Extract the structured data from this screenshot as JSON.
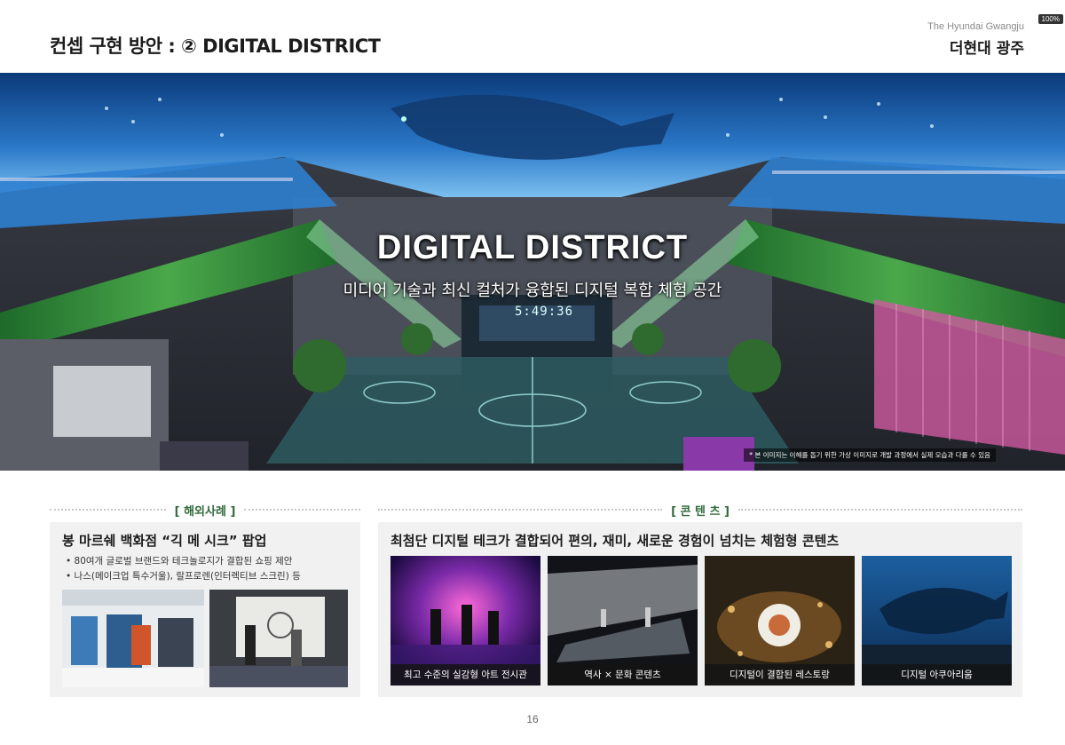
{
  "header": {
    "slide_title": "컨셉 구현 방안 : ② DIGITAL DISTRICT",
    "brand_en": "The Hyundai Gwangju",
    "brand_ko": "더현대 광주",
    "zoom_badge": "100%"
  },
  "hero": {
    "title": "DIGITAL DISTRICT",
    "subtitle": "미디어 기술과 최신 컬처가 융합된 디지털 복합 체험 공간",
    "clock": "5:49:36",
    "disclaimer": "* 본 이미지는 이해를 돕기 위한 가상 이미지로 개발 과정에서 실제 모습과 다를 수 있음"
  },
  "overseas": {
    "section_label": "[ 해외사례 ]",
    "case_title": "봉 마르쉐 백화점 “긱 메 시크” 팝업",
    "bullets": [
      "80여개 글로벌 브랜드와 테크놀로지가 결합된 쇼핑 제안",
      "나스(메이크업 특수거울), 랄프로렌(인터렉티브 스크린) 등"
    ]
  },
  "contents": {
    "section_label": "[ 콘 텐 츠 ]",
    "title": "최첨단 디지털 테크가 결합되어 편의, 재미, 새로운 경험이 넘치는 체험형 콘텐츠",
    "cards": [
      {
        "caption": "최고 수준의 실감형 아트 전시관"
      },
      {
        "caption": "역사 × 문화 콘텐츠"
      },
      {
        "caption": "디지털이 결합된 레스토랑"
      },
      {
        "caption": "디지털 아쿠아리움"
      }
    ]
  },
  "footer": {
    "page_number": "16"
  },
  "colors": {
    "accent_green": "#2f6a3a",
    "panel_bg": "#f1f1f1"
  }
}
